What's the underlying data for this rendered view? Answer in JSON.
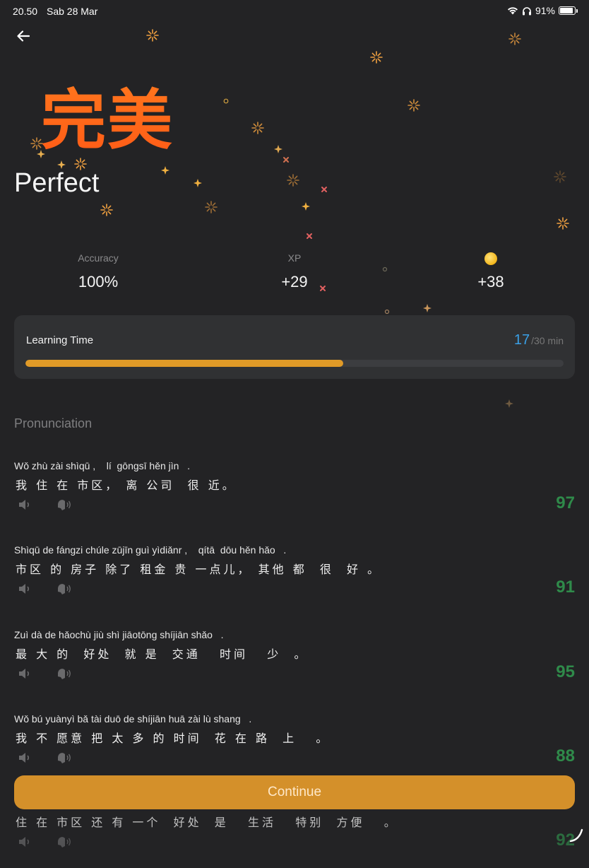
{
  "status_bar": {
    "time": "20.50",
    "date": "Sab 28 Mar",
    "battery": "91%"
  },
  "header": {
    "back_icon": "arrow-left-icon"
  },
  "result": {
    "title_zh": "完美",
    "title": "Perfect"
  },
  "stats": [
    {
      "label": "Accuracy",
      "value": "100%"
    },
    {
      "label": "XP",
      "value": "+29"
    },
    {
      "label": "",
      "icon": "coin-icon",
      "value": "+38"
    }
  ],
  "learning_time": {
    "label": "Learning Time",
    "current": "17",
    "total": "/30 min",
    "progress": 0.59
  },
  "pronunciation": {
    "title": "Pronunciation",
    "items": [
      {
        "pinyin": "Wǒ zhù zài shìqū ,    lí  gōngsī hěn jìn   .",
        "hanzi": "我 住 在 市区， 离 公司  很 近。",
        "score": "97"
      },
      {
        "pinyin": "Shìqū de fángzi chúle zūjīn guì yìdiǎnr ,    qítā  dōu hěn hǎo   .",
        "hanzi": "市区 的 房子 除了 租金 贵 一点儿， 其他 都  很  好 。",
        "score": "91"
      },
      {
        "pinyin": "Zuì dà de hǎochù jiù shì jiāotōng shíjiān shǎo   .",
        "hanzi": "最 大 的  好处  就 是  交通   时间   少  。",
        "score": "95"
      },
      {
        "pinyin": "Wǒ bú yuànyì bǎ tài duō de shíjiān huā zài lù shang   .",
        "hanzi": "我 不 愿意 把 太 多 的 时间  花 在 路  上   。",
        "score": "88"
      },
      {
        "pinyin": "",
        "hanzi": "住 在 市区 还 有 一个  好处  是   生活   特别  方便   。",
        "score": "92"
      }
    ]
  },
  "actions": {
    "continue": "Continue"
  },
  "colors": {
    "accent": "#d4902a",
    "score": "#2f8a4a",
    "title": "#ff6a1a",
    "time_current": "#3aa0e6"
  }
}
